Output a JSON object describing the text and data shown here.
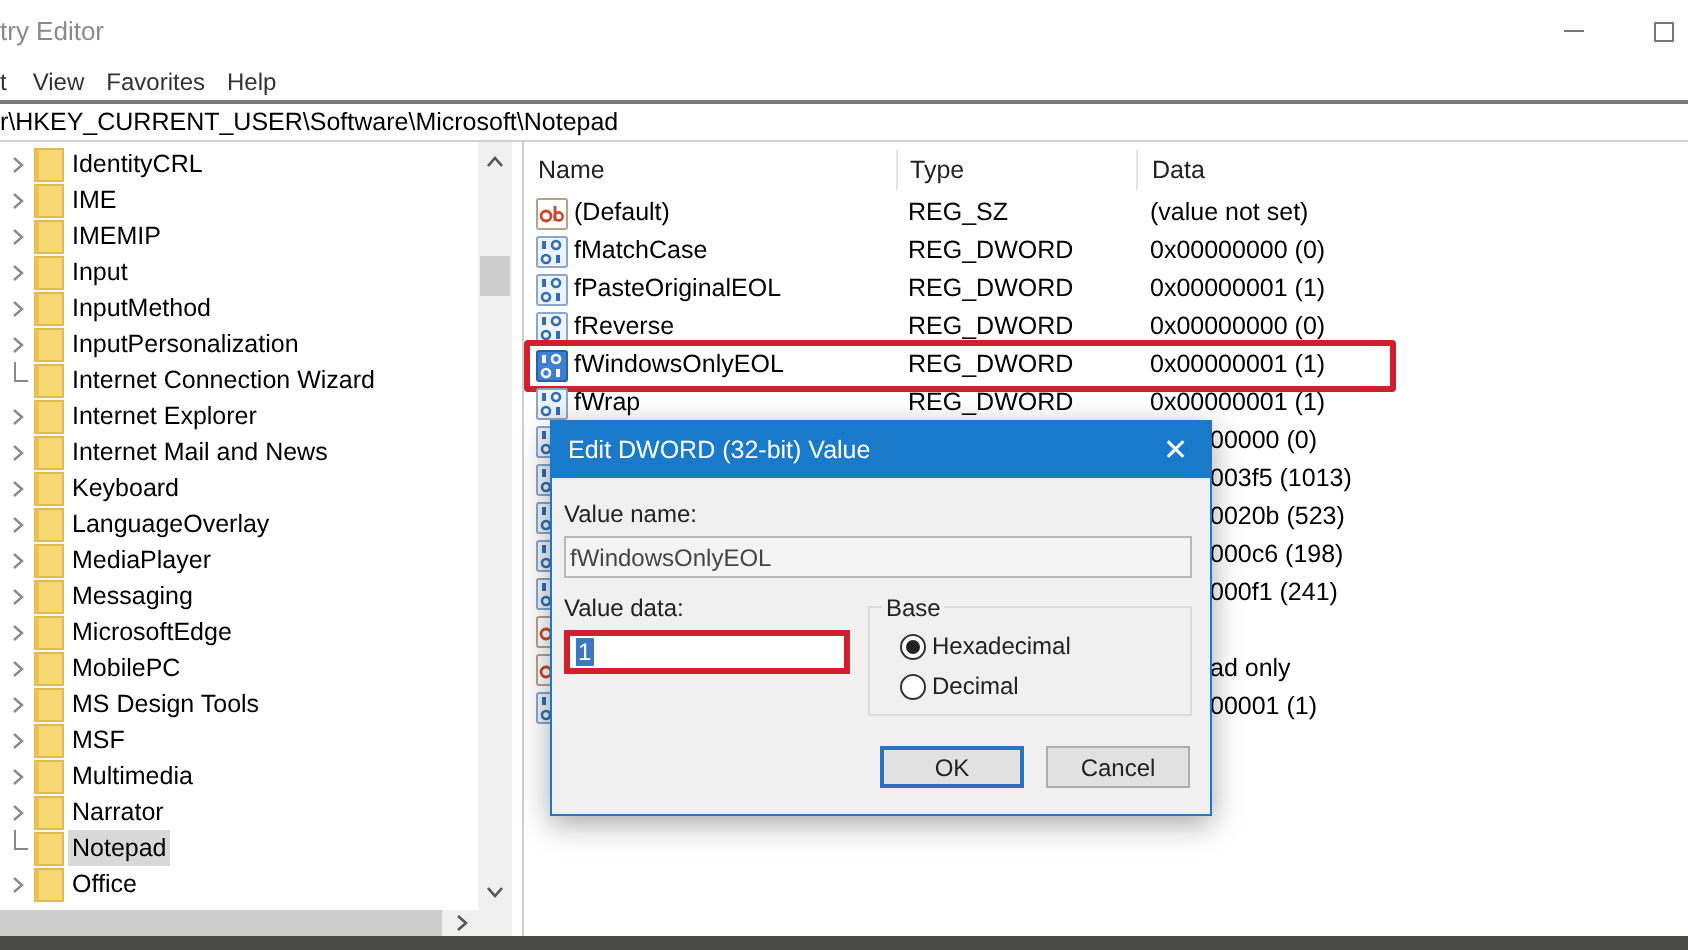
{
  "window": {
    "title": "try Editor"
  },
  "menu": [
    "t",
    "View",
    "Favorites",
    "Help"
  ],
  "address": "r\\HKEY_CURRENT_USER\\Software\\Microsoft\\Notepad",
  "tree": [
    {
      "label": "IdentityCRL",
      "expandable": true,
      "selected": false
    },
    {
      "label": "IME",
      "expandable": true,
      "selected": false
    },
    {
      "label": "IMEMIP",
      "expandable": true,
      "selected": false
    },
    {
      "label": "Input",
      "expandable": true,
      "selected": false
    },
    {
      "label": "InputMethod",
      "expandable": true,
      "selected": false
    },
    {
      "label": "InputPersonalization",
      "expandable": true,
      "selected": false
    },
    {
      "label": "Internet Connection Wizard",
      "expandable": false,
      "selected": false
    },
    {
      "label": "Internet Explorer",
      "expandable": true,
      "selected": false
    },
    {
      "label": "Internet Mail and News",
      "expandable": true,
      "selected": false
    },
    {
      "label": "Keyboard",
      "expandable": true,
      "selected": false
    },
    {
      "label": "LanguageOverlay",
      "expandable": true,
      "selected": false
    },
    {
      "label": "MediaPlayer",
      "expandable": true,
      "selected": false
    },
    {
      "label": "Messaging",
      "expandable": true,
      "selected": false
    },
    {
      "label": "MicrosoftEdge",
      "expandable": true,
      "selected": false
    },
    {
      "label": "MobilePC",
      "expandable": true,
      "selected": false
    },
    {
      "label": "MS Design Tools",
      "expandable": true,
      "selected": false
    },
    {
      "label": "MSF",
      "expandable": true,
      "selected": false
    },
    {
      "label": "Multimedia",
      "expandable": true,
      "selected": false
    },
    {
      "label": "Narrator",
      "expandable": true,
      "selected": false
    },
    {
      "label": "Notepad",
      "expandable": false,
      "selected": true
    },
    {
      "label": "Office",
      "expandable": true,
      "selected": false
    }
  ],
  "table": {
    "columns": [
      "Name",
      "Type",
      "Data"
    ],
    "rows": [
      {
        "kind": "string",
        "name": "(Default)",
        "type": "REG_SZ",
        "data": "(value not set)",
        "highlighted": false
      },
      {
        "kind": "dword",
        "name": "fMatchCase",
        "type": "REG_DWORD",
        "data": "0x00000000 (0)",
        "highlighted": false
      },
      {
        "kind": "dword",
        "name": "fPasteOriginalEOL",
        "type": "REG_DWORD",
        "data": "0x00000001 (1)",
        "highlighted": false
      },
      {
        "kind": "dword",
        "name": "fReverse",
        "type": "REG_DWORD",
        "data": "0x00000000 (0)",
        "highlighted": false
      },
      {
        "kind": "dword",
        "name": "fWindowsOnlyEOL",
        "type": "REG_DWORD",
        "data": "0x00000001 (1)",
        "highlighted": true
      },
      {
        "kind": "dword",
        "name": "fWrap",
        "type": "REG_DWORD",
        "data": "0x00000001 (1)",
        "highlighted": false
      },
      {
        "kind": "dword",
        "data": "00000 (0)"
      },
      {
        "kind": "dword",
        "data": "003f5 (1013)"
      },
      {
        "kind": "dword",
        "data": "0020b (523)"
      },
      {
        "kind": "dword",
        "data": "000c6 (198)"
      },
      {
        "kind": "dword",
        "data": "000f1 (241)"
      },
      {
        "kind": "string"
      },
      {
        "kind": "string",
        "data": "ad only"
      },
      {
        "kind": "dword",
        "data": "00001 (1)"
      }
    ]
  },
  "dialog": {
    "title": "Edit DWORD (32-bit) Value",
    "close": "✕",
    "value_name_label": "Value name:",
    "value_name": "fWindowsOnlyEOL",
    "value_data_label": "Value data:",
    "value_data": "1",
    "value_data_highlighted": true,
    "base_label": "Base",
    "base_options": [
      {
        "label": "Hexadecimal",
        "selected": true
      },
      {
        "label": "Decimal",
        "selected": false
      }
    ],
    "buttons": [
      {
        "label": "OK",
        "default": true
      },
      {
        "label": "Cancel",
        "default": false
      }
    ]
  }
}
